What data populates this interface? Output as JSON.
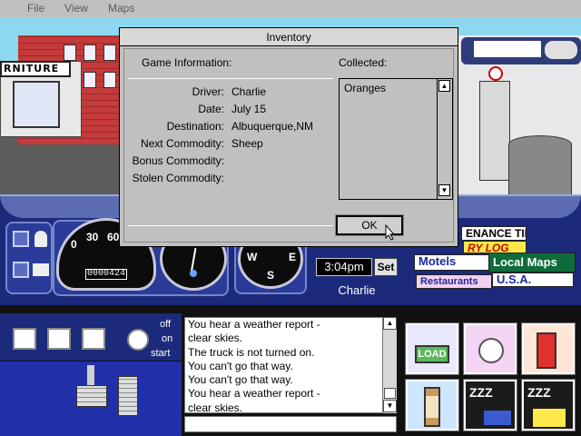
{
  "menu": {
    "items": [
      "File",
      "View",
      "Maps"
    ]
  },
  "scene": {
    "store_sign": "RNITURE"
  },
  "dialog": {
    "title": "Inventory",
    "game_info_heading": "Game Information:",
    "collected_heading": "Collected:",
    "fields": [
      {
        "label": "Driver:",
        "value": "Charlie"
      },
      {
        "label": "Date:",
        "value": "July 15"
      },
      {
        "label": "Destination:",
        "value": "Albuquerque,NM"
      },
      {
        "label": "Next Commodity:",
        "value": "Sheep"
      },
      {
        "label": "Bonus Commodity:",
        "value": ""
      },
      {
        "label": "Stolen Commodity:",
        "value": ""
      }
    ],
    "collected_items": [
      "Oranges"
    ],
    "ok_label": "OK"
  },
  "dashboard": {
    "speedometer_ticks": [
      "0",
      "30",
      "60"
    ],
    "odometer": "0000424",
    "compass_labels": [
      "W",
      "E",
      "S"
    ],
    "clock": "3:04pm",
    "set_label": "Set",
    "driver": "Charlie"
  },
  "books": {
    "maintenance": "ENANCE TIPS",
    "log": "RY LOG",
    "motels": "Motels",
    "local_maps": "Local Maps",
    "restaurants": "Restaurants",
    "usa": "U.S.A."
  },
  "controls": {
    "off": "off",
    "on": "on",
    "start": "start"
  },
  "messages": [
    "You hear a weather report -",
    "clear skies.",
    "The truck is not turned on.",
    "You can't go that way.",
    "You can't go that way.",
    "You hear a weather report -",
    "clear skies."
  ],
  "action_icons": [
    "load-icon",
    "restaurant-icon",
    "gas-pump-icon",
    "hourglass-icon",
    "sleep-truck-icon",
    "sleep-motel-icon"
  ],
  "colors": {
    "dashboard": "#1b2a7b",
    "sky": "#8ed7f0",
    "dialog": "#c0c0c0"
  }
}
